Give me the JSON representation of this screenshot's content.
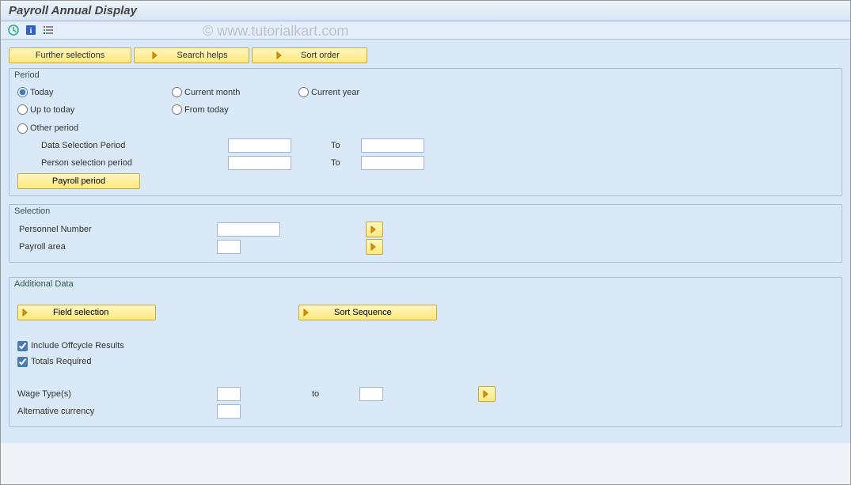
{
  "title": "Payroll Annual Display",
  "watermark": "© www.tutorialkart.com",
  "top_buttons": {
    "further_selections": "Further selections",
    "search_helps": "Search helps",
    "sort_order": "Sort order"
  },
  "period": {
    "title": "Period",
    "today": "Today",
    "current_month": "Current month",
    "current_year": "Current year",
    "up_to_today": "Up to today",
    "from_today": "From today",
    "other_period": "Other period",
    "data_selection_period": "Data Selection Period",
    "person_selection_period": "Person selection period",
    "to": "To",
    "payroll_period_btn": "Payroll period"
  },
  "selection": {
    "title": "Selection",
    "personnel_number": "Personnel Number",
    "payroll_area": "Payroll area"
  },
  "additional": {
    "title": "Additional Data",
    "field_selection": "Field selection",
    "sort_sequence": "Sort Sequence",
    "include_offcycle": "Include Offcycle Results",
    "totals_required": "Totals Required",
    "wage_types": "Wage Type(s)",
    "to": "to",
    "alternative_currency": "Alternative currency"
  }
}
